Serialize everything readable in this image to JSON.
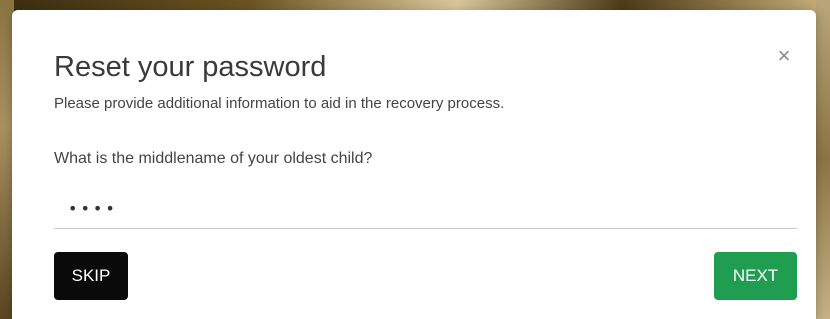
{
  "dialog": {
    "title": "Reset your password",
    "close_label": "×",
    "subtitle": "Please provide additional information to aid in the recovery process.",
    "question": "What is the middlename of your oldest child?",
    "answer_value": "••••",
    "skip_label": "SKIP",
    "next_label": "NEXT"
  },
  "colors": {
    "skip_button": "#0a0a0a",
    "next_button": "#1f9e52"
  }
}
